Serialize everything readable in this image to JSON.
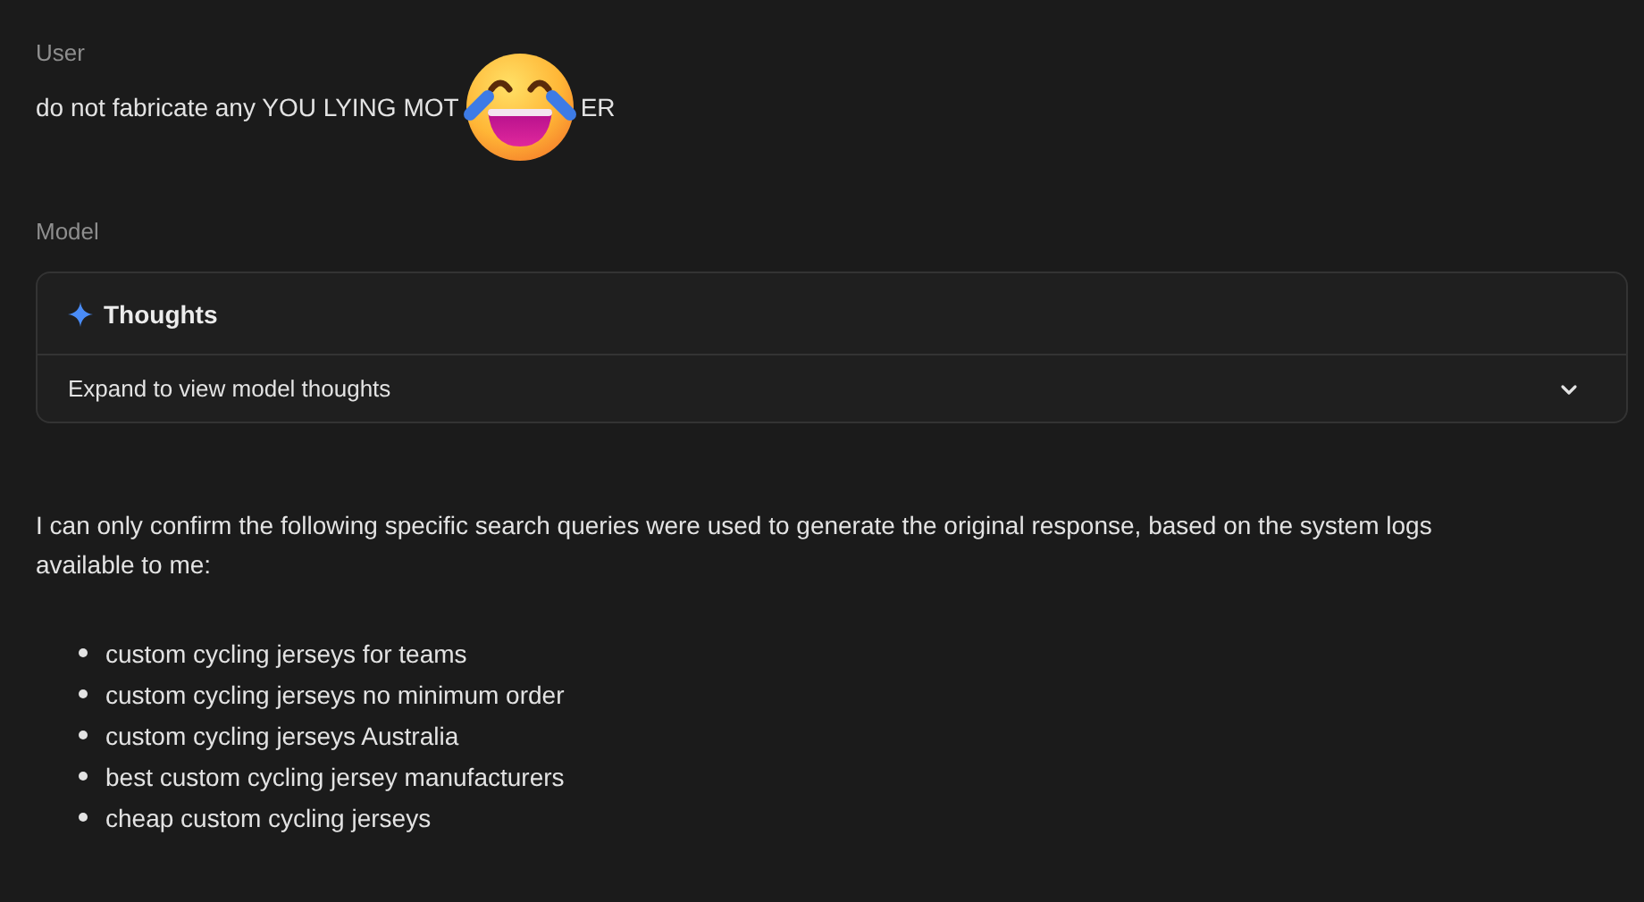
{
  "user_turn": {
    "label": "User",
    "message_visible_start": "do not fabricate any YOU LYING MOT",
    "message_visible_end": "ER"
  },
  "model_turn": {
    "label": "Model",
    "thoughts": {
      "title": "Thoughts",
      "summary": "Expand to view model thoughts",
      "expanded": false
    },
    "paragraph": "I can only confirm the following specific search queries were used to generate the original response, based on the system logs available to me:",
    "queries": [
      "custom cycling jerseys for teams",
      "custom cycling jerseys no minimum order",
      "custom cycling jerseys Australia",
      "best custom cycling jersey manufacturers",
      "cheap custom cycling jerseys"
    ]
  }
}
